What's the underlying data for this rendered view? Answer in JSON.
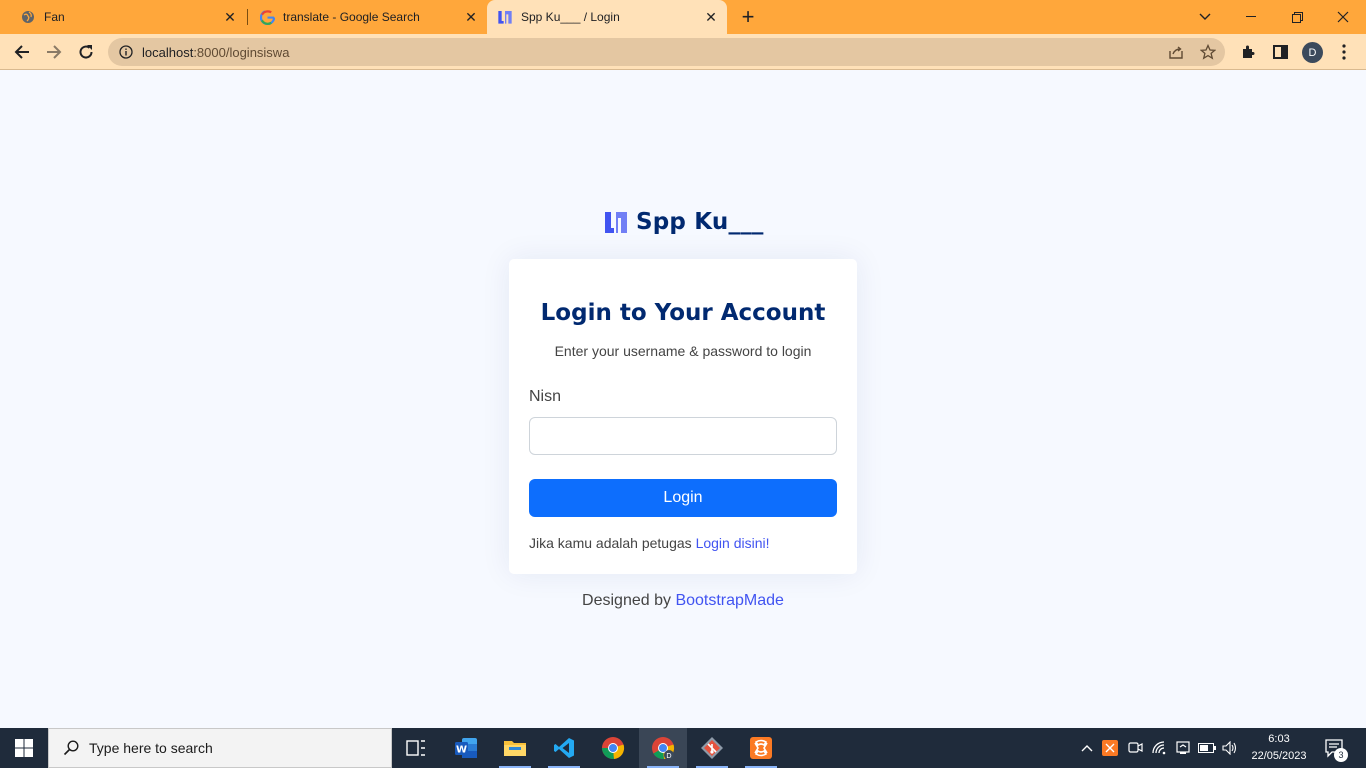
{
  "browser": {
    "tabs": [
      {
        "title": "Fan",
        "icon": "globe-icon"
      },
      {
        "title": "translate - Google Search",
        "icon": "google-icon"
      },
      {
        "title": "Spp Ku___ / Login",
        "icon": "nice-admin-logo-icon",
        "active": true
      }
    ],
    "url_host": "localhost",
    "url_path": ":8000/loginsiswa",
    "profile_initial": "D",
    "accent_color": "#ffa73b"
  },
  "page": {
    "brand": "Spp Ku___",
    "title": "Login to Your Account",
    "subtitle": "Enter your username & password to login",
    "nisn_label": "Nisn",
    "nisn_value": "",
    "login_button": "Login",
    "hint_text": "Jika kamu adalah petugas ",
    "hint_link": "Login disini!",
    "credits_text": "Designed by ",
    "credits_link": "BootstrapMade",
    "brand_color": "#012970",
    "button_color": "#0d6efd",
    "link_color": "#4154f1"
  },
  "taskbar": {
    "search_placeholder": "Type here to search",
    "apps": [
      "task-view-icon",
      "word-icon",
      "file-explorer-icon",
      "vscode-icon",
      "chrome-icon",
      "chrome-profile-icon",
      "git-icon",
      "xampp-icon"
    ],
    "time": "6:03",
    "date": "22/05/2023",
    "notification_count": "3"
  }
}
